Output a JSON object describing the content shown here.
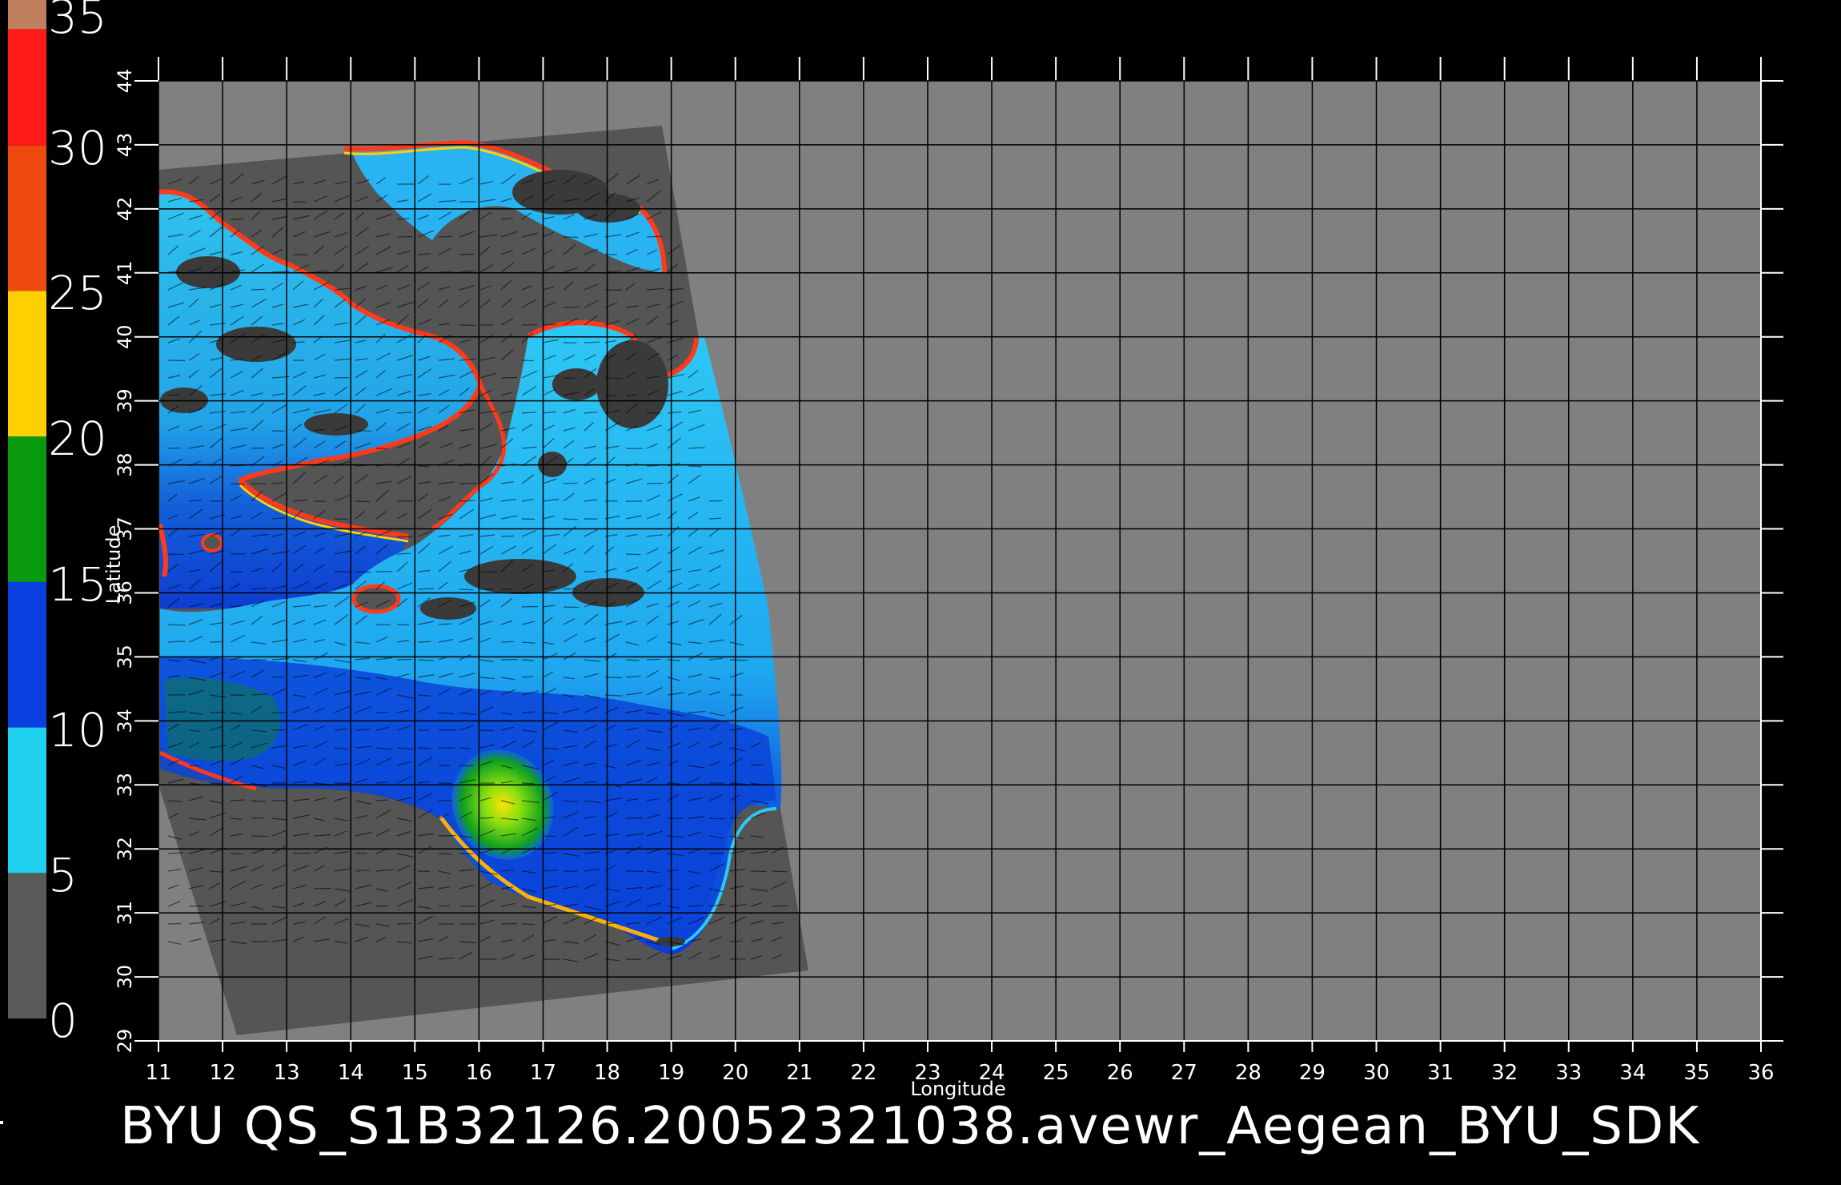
{
  "colorbar": {
    "tick_labels": [
      "0",
      "5",
      "10",
      "15",
      "20",
      "25",
      "30",
      "35"
    ],
    "tick_values": [
      0,
      5,
      10,
      15,
      20,
      25,
      30,
      35
    ],
    "range": [
      0,
      35
    ],
    "segments": [
      {
        "from": 0,
        "to": 5,
        "color": "#5a5a5a"
      },
      {
        "from": 5,
        "to": 10,
        "color": "#1fd0f0"
      },
      {
        "from": 10,
        "to": 15,
        "color": "#0a40e0"
      },
      {
        "from": 15,
        "to": 20,
        "color": "#0a9a10"
      },
      {
        "from": 20,
        "to": 25,
        "color": "#ffd000"
      },
      {
        "from": 25,
        "to": 30,
        "color": "#ee4a10"
      },
      {
        "from": 30,
        "to": 34,
        "color": "#ff1a1a"
      },
      {
        "from": 34,
        "to": 35,
        "color": "#c08060"
      }
    ]
  },
  "axes": {
    "xlabel": "Longitude",
    "ylabel": "Latitude",
    "x_ticks": [
      "11",
      "12",
      "13",
      "14",
      "15",
      "16",
      "17",
      "18",
      "19",
      "20",
      "21",
      "22",
      "23",
      "24",
      "25",
      "26",
      "27",
      "28",
      "29",
      "30",
      "31",
      "32",
      "33",
      "34",
      "35",
      "36"
    ],
    "y_ticks": [
      "29",
      "30",
      "31",
      "32",
      "33",
      "34",
      "35",
      "36",
      "37",
      "38",
      "39",
      "40",
      "41",
      "42",
      "43",
      "44"
    ],
    "x_range": [
      11,
      36
    ],
    "y_range": [
      29,
      44
    ]
  },
  "colors": {
    "background": "#000000",
    "plot_background": "#808080",
    "land_swath": "#555555",
    "grid": "#000000",
    "text": "#ffffff"
  },
  "footer": {
    "title": "BYU  QS_S1B32126.20052321038.avewr_Aegean_BYU_SDK"
  }
}
